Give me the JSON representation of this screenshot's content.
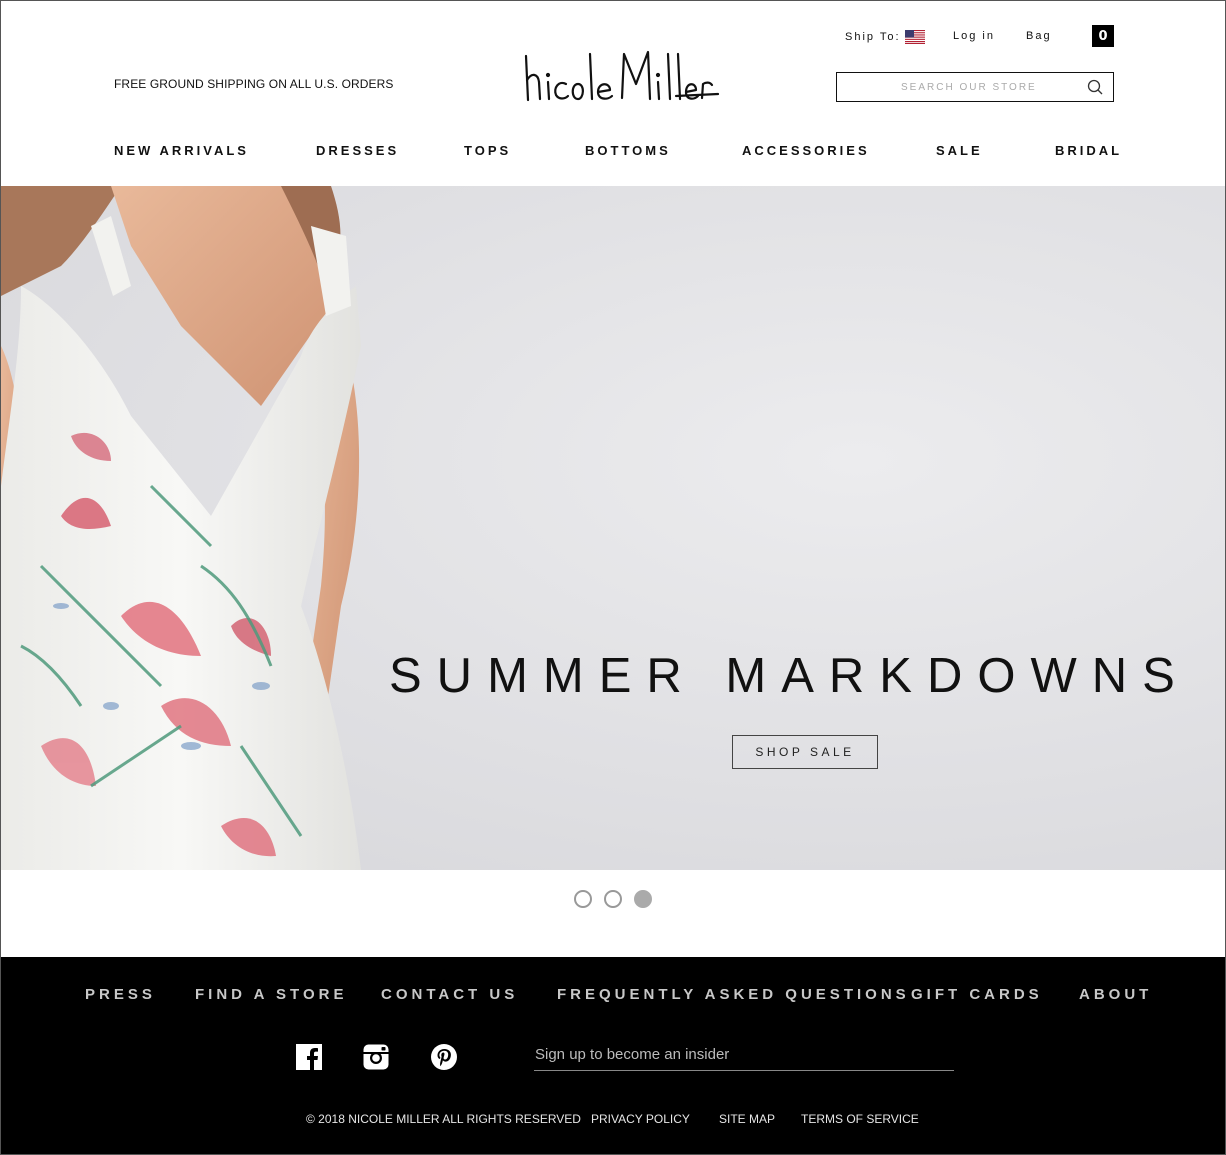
{
  "header": {
    "promo": "FREE GROUND SHIPPING ON ALL U.S. ORDERS",
    "logo_text": "nicole miller",
    "ship_to": "Ship To:",
    "login": "Log in",
    "bag": "Bag",
    "bag_count": "0",
    "search_placeholder": "SEARCH OUR STORE"
  },
  "nav": [
    "NEW ARRIVALS",
    "DRESSES",
    "TOPS",
    "BOTTOMS",
    "ACCESSORIES",
    "SALE",
    "BRIDAL"
  ],
  "hero": {
    "title": "SUMMER MARKDOWNS",
    "button": "SHOP SALE"
  },
  "carousel": {
    "slides": 3,
    "active_index": 2
  },
  "footer": {
    "links": [
      "PRESS",
      "FIND A STORE",
      "CONTACT US",
      "FREQUENTLY ASKED QUESTIONS",
      "GIFT CARDS",
      "ABOUT"
    ],
    "social": [
      "facebook-icon",
      "instagram-icon",
      "pinterest-icon"
    ],
    "newsletter_placeholder": "Sign up to become an insider",
    "copyright": "© 2018 NICOLE MILLER ALL RIGHTS RESERVED",
    "legal": [
      "PRIVACY POLICY",
      "SITE MAP",
      "TERMS OF SERVICE"
    ]
  },
  "colors": {
    "footer_bg": "#000000",
    "hero_bg": "#e2e2e5",
    "footer_text": "#c8c8c8"
  }
}
